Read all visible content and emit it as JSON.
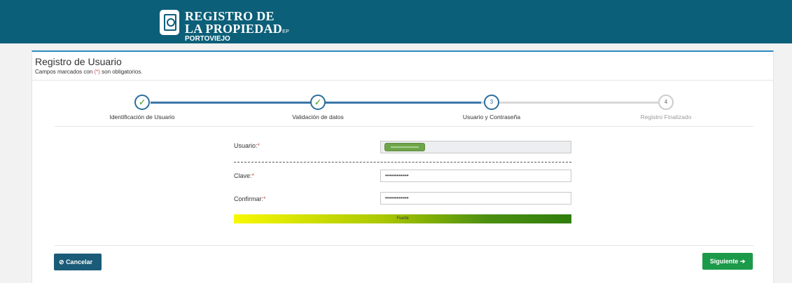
{
  "header": {
    "logo_line1": "REGISTRO DE",
    "logo_line2": "LA PROPIEDAD",
    "logo_suffix": "EP",
    "logo_line3": "PORTOVIEJO",
    "bg_color": "#0c5f78"
  },
  "panel": {
    "title": "Registro de Usuario",
    "subtitle_pre": "Campos marcados con ",
    "subtitle_mark": "(*)",
    "subtitle_post": " son obligatorios."
  },
  "steps": [
    {
      "label": "Identificación de Usuario",
      "state": "done",
      "icon": "check-icon"
    },
    {
      "label": "Validación de datos",
      "state": "done",
      "icon": "check-icon"
    },
    {
      "label": "Usuario y Contraseña",
      "state": "active",
      "number": "3"
    },
    {
      "label": "Registro Finalizado",
      "state": "todo",
      "number": "4"
    }
  ],
  "form": {
    "usuario_label": "Usuario:",
    "clave_label": "Clave:",
    "confirmar_label": "Confirmar:",
    "required_mark": "*",
    "clave_value": "••••••••••••",
    "confirmar_value": "••••••••••••",
    "strength_text": "Fuerte"
  },
  "buttons": {
    "cancel_icon": "⊘",
    "cancel_label": "Cancelar",
    "next_label": "Siguiente",
    "next_icon": "➔"
  },
  "colors": {
    "accent": "#2c6e9c",
    "done": "#6ab04c",
    "cancel": "#1a5b77",
    "next": "#1c9a4a"
  }
}
